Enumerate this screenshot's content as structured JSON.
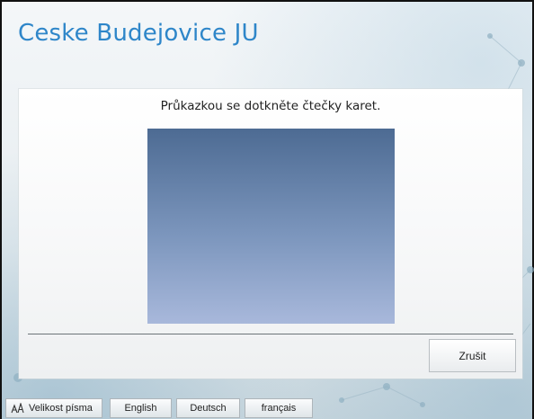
{
  "header": {
    "title": "Ceske Budejovice JU"
  },
  "panel": {
    "instruction": "Průkazkou se dotkněte čtečky karet."
  },
  "actions": {
    "cancel_label": "Zrušit"
  },
  "bottom_bar": {
    "font_size_label": "Velikost písma",
    "languages": [
      "English",
      "Deutsch",
      "français"
    ]
  },
  "colors": {
    "title": "#2e86c9",
    "card_top": "#4d6b93",
    "card_bottom": "#a8b8db"
  },
  "icons": {
    "font_size": "font-size-icon"
  }
}
